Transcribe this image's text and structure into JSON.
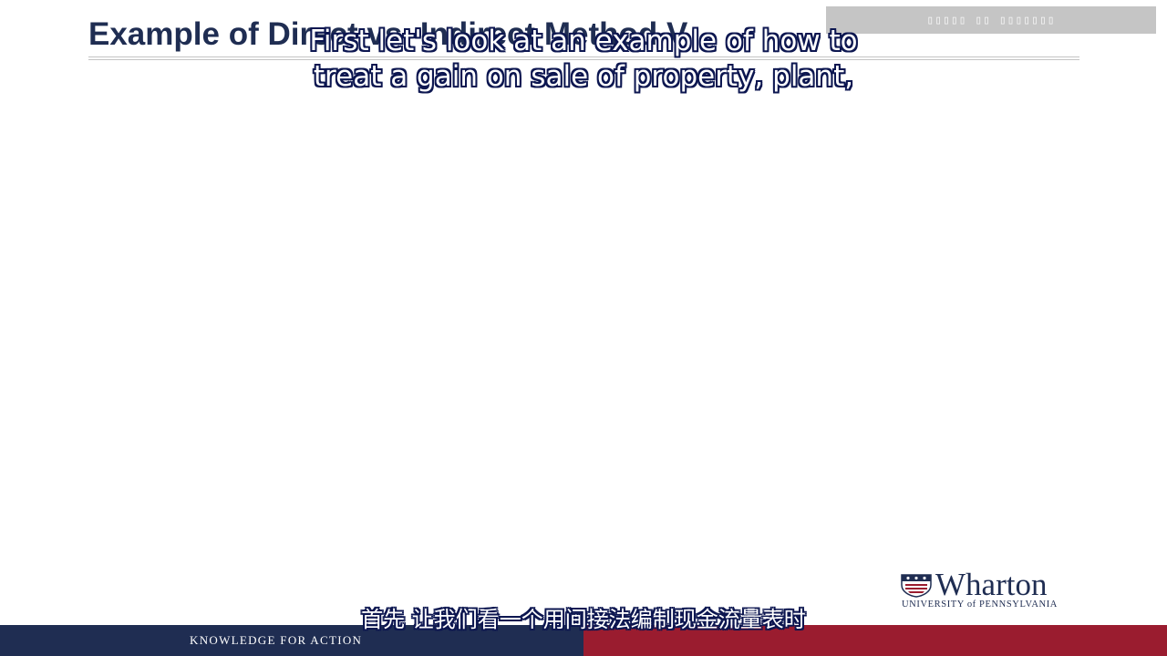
{
  "slide": {
    "title": "Example of Direct vs. Indirect Method V"
  },
  "watermark": {
    "text": "▯▯▯▯▯ ▯▯ ▯▯▯▯▯▯▯"
  },
  "subtitles": {
    "english_line_1": "First let's look at an example of how to",
    "english_line_2": "treat a gain on sale of property, plant,",
    "chinese": "首先 让我们看一个用间接法编制现金流量表时"
  },
  "logo": {
    "wordmark": "Wharton",
    "subline": "UNIVERSITY of PENNSYLVANIA"
  },
  "footer": {
    "tagline": "KNOWLEDGE FOR ACTION"
  },
  "colors": {
    "navy": "#1f2d52",
    "crimson": "#9a1c2f",
    "subtitle_outline": "#0c1650"
  }
}
